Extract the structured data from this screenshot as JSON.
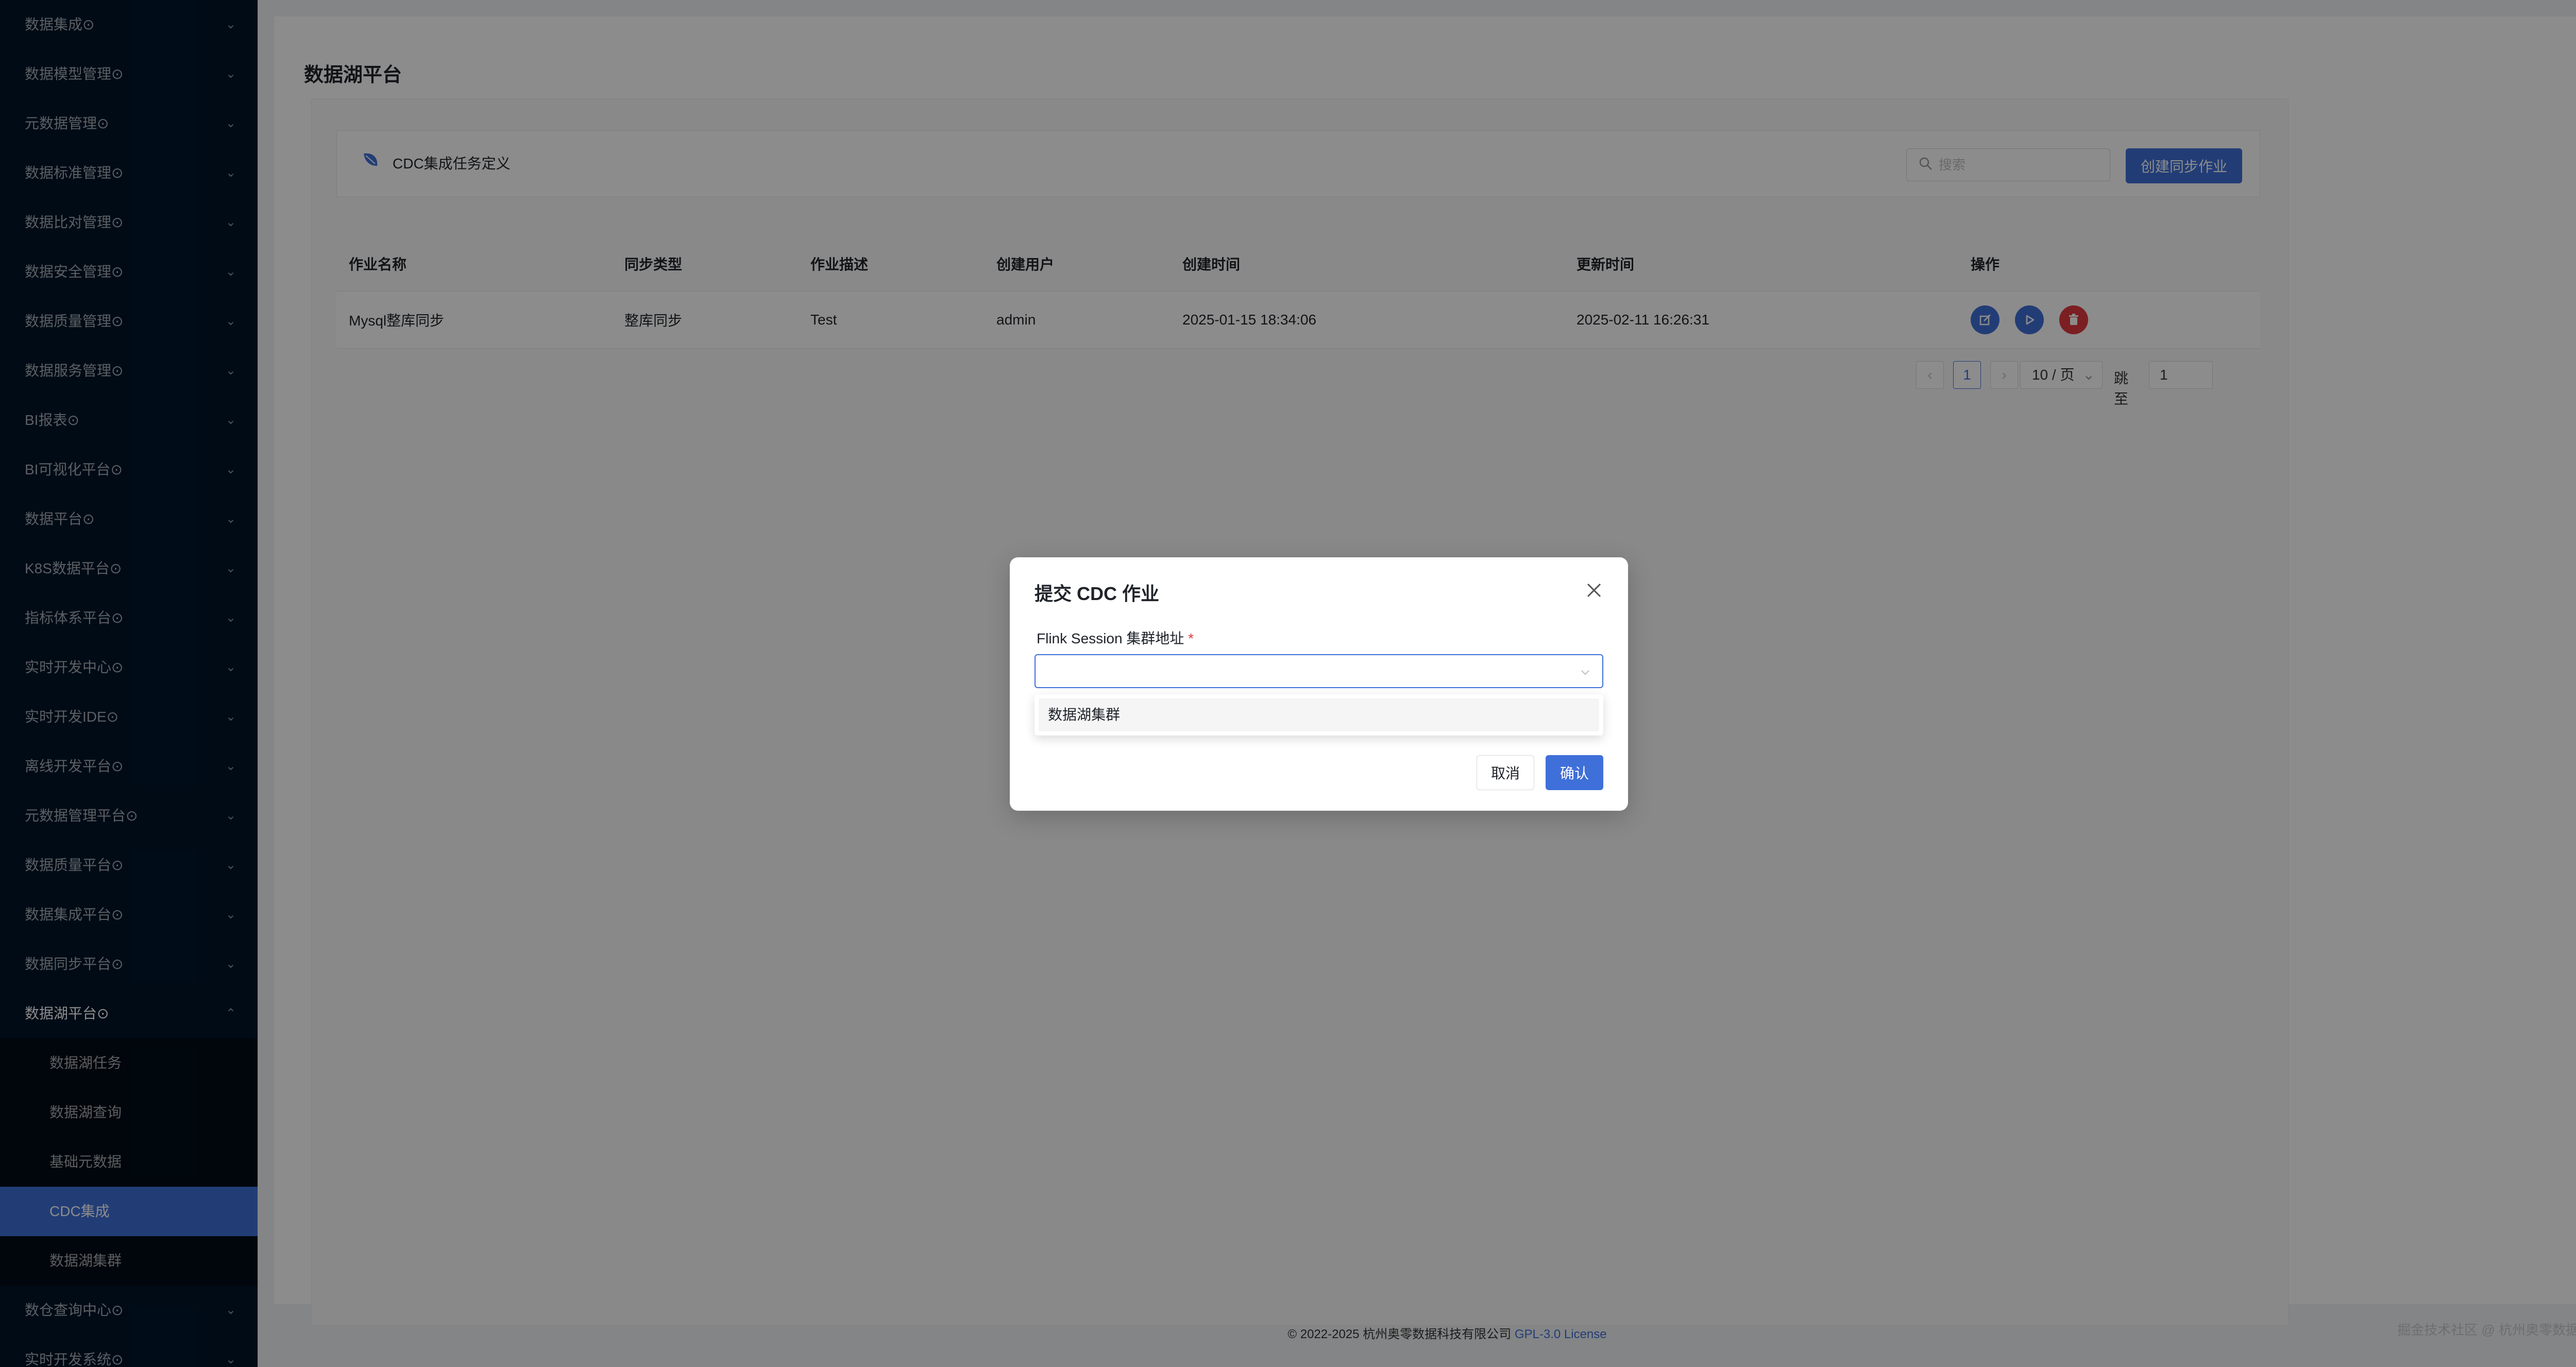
{
  "sidebar": {
    "items_top": [
      {
        "label": "数据集成⊙"
      },
      {
        "label": "数据模型管理⊙"
      },
      {
        "label": "元数据管理⊙"
      },
      {
        "label": "数据标准管理⊙"
      },
      {
        "label": "数据比对管理⊙"
      },
      {
        "label": "数据安全管理⊙"
      },
      {
        "label": "数据质量管理⊙"
      },
      {
        "label": "数据服务管理⊙"
      },
      {
        "label": "BI报表⊙"
      },
      {
        "label": "BI可视化平台⊙"
      },
      {
        "label": "数据平台⊙"
      },
      {
        "label": "K8S数据平台⊙"
      },
      {
        "label": "指标体系平台⊙"
      },
      {
        "label": "实时开发中心⊙"
      },
      {
        "label": "实时开发IDE⊙"
      },
      {
        "label": "离线开发平台⊙"
      },
      {
        "label": "元数据管理平台⊙"
      },
      {
        "label": "数据质量平台⊙"
      },
      {
        "label": "数据集成平台⊙"
      },
      {
        "label": "数据同步平台⊙"
      }
    ],
    "open_item": {
      "label": "数据湖平台⊙"
    },
    "sub_items": [
      {
        "label": "数据湖任务"
      },
      {
        "label": "数据湖查询"
      },
      {
        "label": "基础元数据"
      },
      {
        "label": "CDC集成"
      },
      {
        "label": "数据湖集群"
      }
    ],
    "items_bottom": [
      {
        "label": "数仓查询中心⊙"
      },
      {
        "label": "实时开发系统⊙"
      }
    ],
    "active_sub": "CDC集成"
  },
  "main": {
    "page_title": "数据湖平台",
    "toolbar": {
      "title": "CDC集成任务定义",
      "search_placeholder": "搜索",
      "create_button": "创建同步作业"
    },
    "table": {
      "headers": [
        "作业名称",
        "同步类型",
        "作业描述",
        "创建用户",
        "创建时间",
        "更新时间",
        "操作"
      ],
      "rows": [
        {
          "name": "Mysql整库同步",
          "type": "整库同步",
          "desc": "Test",
          "user": "admin",
          "created": "2025-01-15 18:34:06",
          "updated": "2025-02-11 16:26:31"
        }
      ]
    },
    "pagination": {
      "prev": "‹",
      "current_page": "1",
      "next": "›",
      "page_size": "10 / 页",
      "jump_label": "跳至",
      "jump_value": "1"
    }
  },
  "footer": {
    "copyright": "© 2022-2025 杭州奥零数据科技有限公司",
    "license": "GPL-3.0 License",
    "watermark": "掘金技术社区 @ 杭州奥零数据科技"
  },
  "modal": {
    "title": "提交 CDC 作业",
    "field_label": "Flink Session 集群地址",
    "required_mark": "*",
    "select_value": "",
    "options": [
      "数据湖集群"
    ],
    "cancel_button": "取消",
    "confirm_button": "确认"
  },
  "colors": {
    "primary": "#3f6fd8",
    "danger": "#e0393e",
    "sidebar_bg": "#001529"
  }
}
